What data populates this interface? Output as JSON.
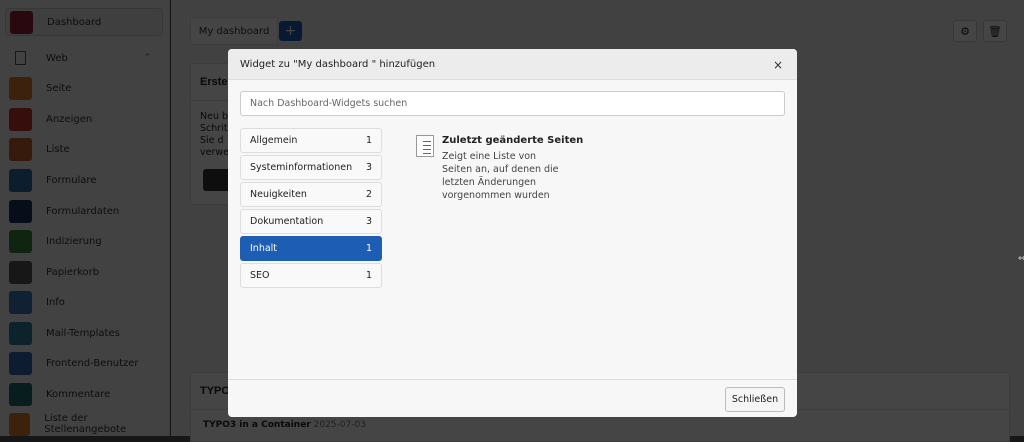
{
  "sidebar": {
    "items": [
      {
        "label": "Dashboard",
        "icon": "dashboard-icon",
        "color": "#9b1c3c",
        "active": true
      },
      {
        "label": "Web",
        "icon": "page-icon",
        "color": "",
        "group": true
      },
      {
        "label": "Seite",
        "icon": "page-icon",
        "color": "#e07b2c"
      },
      {
        "label": "Anzeigen",
        "icon": "eye-icon",
        "color": "#c8322e"
      },
      {
        "label": "Liste",
        "icon": "list-icon",
        "color": "#c8622e"
      },
      {
        "label": "Formulare",
        "icon": "form-icon",
        "color": "#2d6ea8"
      },
      {
        "label": "Formulardaten",
        "icon": "form-data-icon",
        "color": "#1a2f5c"
      },
      {
        "label": "Indizierung",
        "icon": "index-icon",
        "color": "#3c8a3c"
      },
      {
        "label": "Papierkorb",
        "icon": "trash-icon",
        "color": "#555555"
      },
      {
        "label": "Info",
        "icon": "info-icon",
        "color": "#3b7bbf"
      },
      {
        "label": "Mail-Templates",
        "icon": "mail-icon",
        "color": "#2f7fa0"
      },
      {
        "label": "Frontend-Benutzer",
        "icon": "user-icon",
        "color": "#3166b5"
      },
      {
        "label": "Kommentare",
        "icon": "comment-icon",
        "color": "#1d6a6a"
      },
      {
        "label": "Liste der Stellenangebote",
        "icon": "jobs-icon",
        "color": "#e07b2c"
      }
    ]
  },
  "main": {
    "tab": "My dashboard",
    "add_label": "+",
    "cards": {
      "first_title": "Erste",
      "first_text": [
        "Neu b",
        "Schrit",
        "Sie d",
        "verwe"
      ],
      "typo3_title": "TYPO",
      "news_title": "TYPO3 in a Container",
      "news_date": "2025-07-03"
    }
  },
  "modal": {
    "title": "Widget zu \"My dashboard \" hinzufügen",
    "close": "×",
    "search_placeholder": "Nach Dashboard-Widgets suchen",
    "categories": [
      {
        "label": "Allgemein",
        "count": "1"
      },
      {
        "label": "Systeminformationen",
        "count": "3"
      },
      {
        "label": "Neuigkeiten",
        "count": "2"
      },
      {
        "label": "Dokumentation",
        "count": "3"
      },
      {
        "label": "Inhalt",
        "count": "1",
        "selected": true
      },
      {
        "label": "SEO",
        "count": "1"
      }
    ],
    "widget": {
      "title": "Zuletzt geänderte Seiten",
      "description": "Zeigt eine Liste von Seiten an, auf denen die letzten Änderungen vorgenommen wurden",
      "icon": "list-document-icon"
    },
    "close_button": "Schließen"
  },
  "colors": {
    "accent": "#1d5db4"
  }
}
